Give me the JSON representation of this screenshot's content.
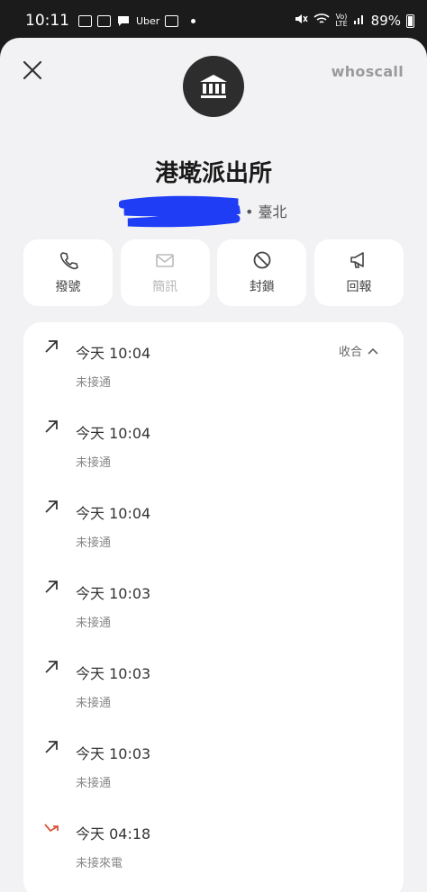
{
  "status_bar": {
    "time": "10:11",
    "uber_label": "Uber",
    "battery": "89%"
  },
  "header": {
    "brand": "whoscall",
    "name": "港墘派出所",
    "location": "• 臺北"
  },
  "actions": [
    {
      "label": "撥號",
      "icon": "phone-icon",
      "enabled": true
    },
    {
      "label": "簡訊",
      "icon": "mail-icon",
      "enabled": false
    },
    {
      "label": "封鎖",
      "icon": "block-icon",
      "enabled": true
    },
    {
      "label": "回報",
      "icon": "megaphone-icon",
      "enabled": true
    }
  ],
  "history": {
    "collapse_label": "收合",
    "items": [
      {
        "time": "今天 10:04",
        "status": "未接通",
        "type": "outgoing"
      },
      {
        "time": "今天 10:04",
        "status": "未接通",
        "type": "outgoing"
      },
      {
        "time": "今天 10:04",
        "status": "未接通",
        "type": "outgoing"
      },
      {
        "time": "今天 10:03",
        "status": "未接通",
        "type": "outgoing"
      },
      {
        "time": "今天 10:03",
        "status": "未接通",
        "type": "outgoing"
      },
      {
        "time": "今天 10:03",
        "status": "未接通",
        "type": "outgoing"
      },
      {
        "time": "今天 04:18",
        "status": "未接來電",
        "type": "missed"
      }
    ]
  },
  "colors": {
    "missed": "#d9533b",
    "scribble": "#1f3df5"
  }
}
